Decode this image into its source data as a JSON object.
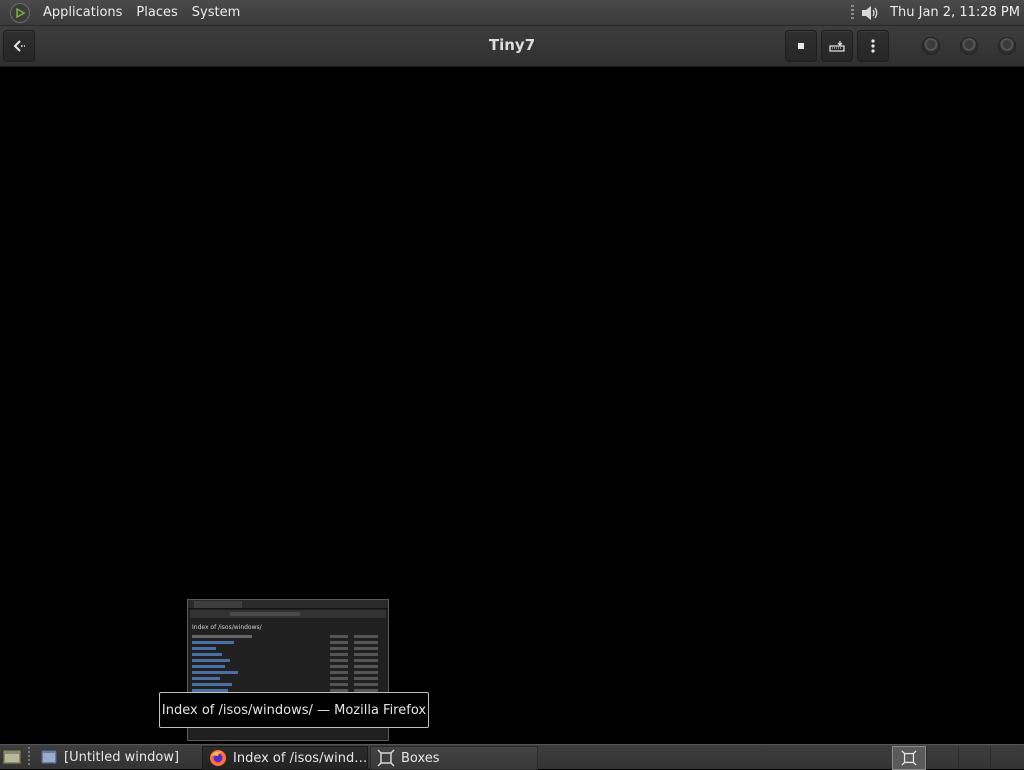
{
  "top_panel": {
    "menus": [
      "Applications",
      "Places",
      "System"
    ],
    "clock": "Thu Jan  2, 11:28 PM",
    "icons": {
      "menu_logo": "mate-logo-icon",
      "volume": "speaker-icon"
    }
  },
  "header": {
    "title": "Tiny7",
    "icons": [
      "back-arrow-icon",
      "stop-icon",
      "keyboard-send-icon",
      "kebab-menu-icon"
    ]
  },
  "window_preview": {
    "page_title": "Index of /isos/windows/"
  },
  "tooltip": {
    "text": "Index of /isos/windows/ — Mozilla Firefox"
  },
  "taskbar": {
    "items": [
      {
        "label": "[Untitled window]",
        "icon": "window-icon"
      },
      {
        "label": "Index of /isos/wind…",
        "icon": "firefox-icon"
      },
      {
        "label": "Boxes",
        "icon": "boxes-icon"
      }
    ],
    "workspaces": 4
  },
  "colors": {
    "panel": "#3a3a3a",
    "header": "#333333",
    "desktop": "#000000",
    "link": "#4a6fa5"
  }
}
